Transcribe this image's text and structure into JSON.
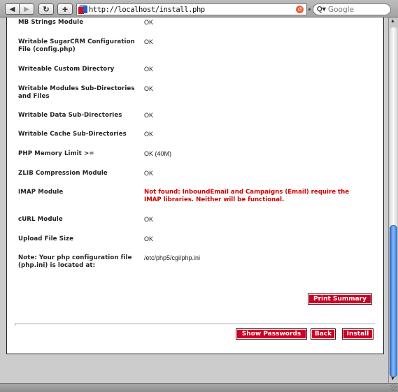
{
  "browser": {
    "url": "http://localhost/install.php",
    "search_placeholder": "Google",
    "icons": {
      "back": "back-arrow-icon",
      "forward": "forward-arrow-icon",
      "reload": "reload-icon",
      "add": "plus-icon",
      "site": "sugarcrm-cube-icon",
      "go": "snapback-icon",
      "search": "search-icon"
    },
    "glyphs": {
      "back": "◀",
      "forward": "▶",
      "reload": "↻",
      "add": "+",
      "go": "↺",
      "search": "Q▾",
      "scroll_up": "▲",
      "scroll_down": "▼"
    }
  },
  "checks": [
    {
      "label": "MB Strings Module",
      "value": "OK",
      "status": "ok"
    },
    {
      "label": "Writable SugarCRM Configuration File (config.php)",
      "value": "OK",
      "status": "ok"
    },
    {
      "label": "Writeable Custom Directory",
      "value": "OK",
      "status": "ok"
    },
    {
      "label": "Writable Modules Sub-Directories and Files",
      "value": "OK",
      "status": "ok"
    },
    {
      "label": "Writable Data Sub-Directories",
      "value": "OK",
      "status": "ok"
    },
    {
      "label": "Writable Cache Sub-Directories",
      "value": "OK",
      "status": "ok"
    },
    {
      "label": "PHP Memory Limit >=",
      "value": "OK (40M)",
      "status": "ok"
    },
    {
      "label": "ZLIB Compression Module",
      "value": "OK",
      "status": "ok"
    },
    {
      "label": "IMAP Module",
      "value": "Not found: InboundEmail and Campaigns (Email) require the IMAP libraries. Neither will be functional.",
      "status": "error"
    },
    {
      "label": "cURL Module",
      "value": "OK",
      "status": "ok"
    },
    {
      "label": "Upload File Size",
      "value": "OK",
      "status": "ok"
    },
    {
      "label": "Note: Your php configuration file (php.ini) is located at:",
      "value": "/etc/php5/cgi/php.ini",
      "status": "info"
    }
  ],
  "buttons": {
    "print_summary": "Print Summary",
    "show_passwords": "Show Passwords",
    "back": "Back",
    "install": "Install"
  },
  "colors": {
    "button_red": "#cc0022",
    "error_red": "#cc0000",
    "scroll_thumb": "#3f86e8"
  },
  "scroll": {
    "position_fraction": 0.92
  }
}
